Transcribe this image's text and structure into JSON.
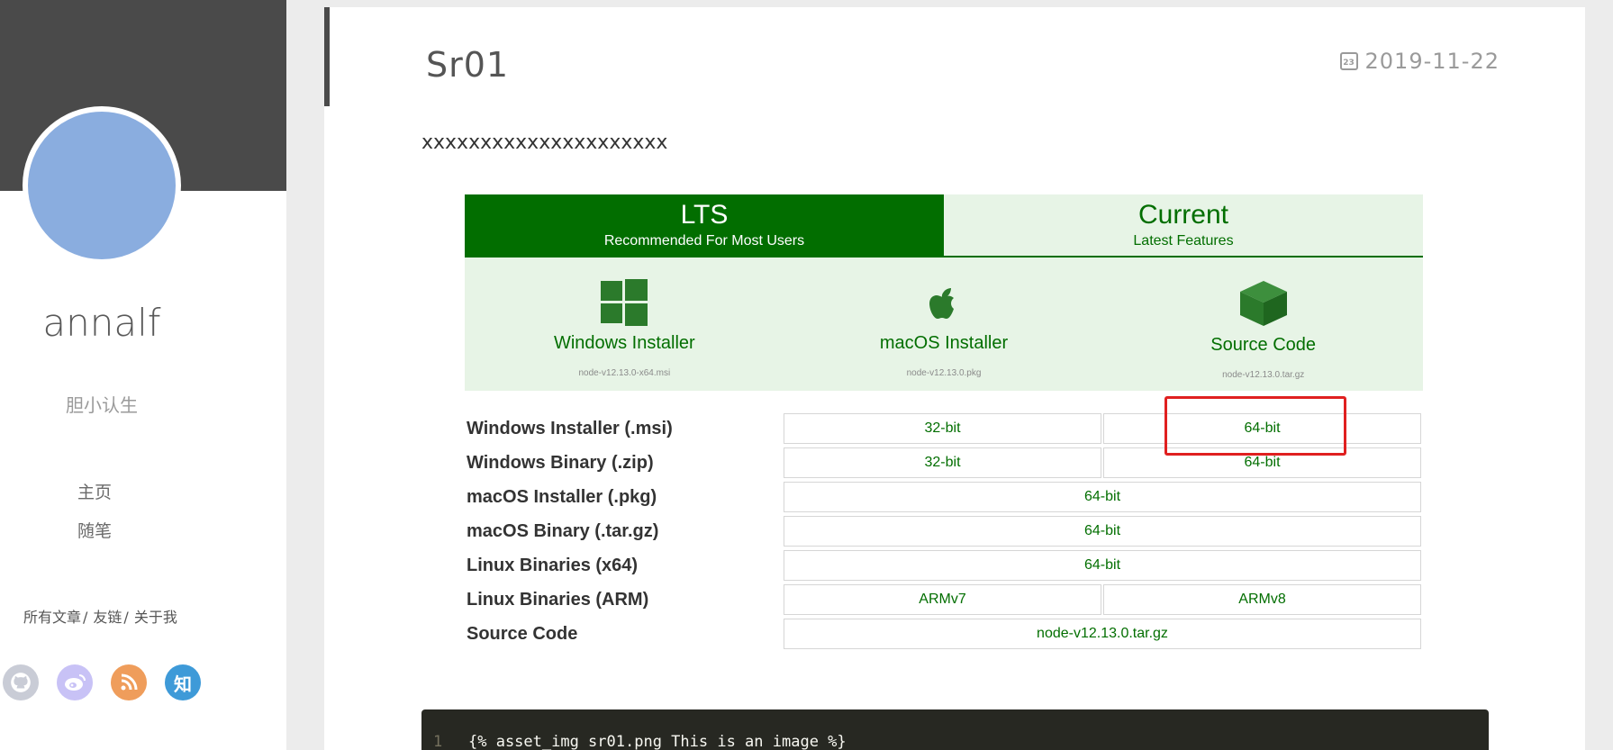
{
  "sidebar": {
    "username": "annalf",
    "motto": "胆小认生",
    "nav": [
      {
        "label": "主页"
      },
      {
        "label": "随笔"
      }
    ],
    "links": [
      {
        "label": "所有文章"
      },
      {
        "label": "友链"
      },
      {
        "label": "关于我"
      }
    ],
    "link_separator": "/",
    "social": [
      {
        "icon": "github-icon",
        "glyph": "",
        "color": "#c9ccd6"
      },
      {
        "icon": "weibo-icon",
        "glyph": "",
        "color": "#c8c2f6"
      },
      {
        "icon": "rss-icon",
        "glyph": "",
        "color": "#ef9d5b"
      },
      {
        "icon": "zhihu-icon",
        "glyph": "知",
        "color": "#3e9ad8"
      }
    ]
  },
  "post": {
    "title": "Sr01",
    "date": "2019-11-22",
    "calendar_day": "23",
    "body_text": "xxxxxxxxxxxxxxxxxxxxx"
  },
  "download_widget": {
    "tabs": [
      {
        "title": "LTS",
        "subtitle": "Recommended For Most Users",
        "active": true
      },
      {
        "title": "Current",
        "subtitle": "Latest Features",
        "active": false
      }
    ],
    "installers": [
      {
        "icon": "windows-icon",
        "label": "Windows Installer",
        "file": "node-v12.13.0-x64.msi"
      },
      {
        "icon": "apple-icon",
        "label": "macOS Installer",
        "file": "node-v12.13.0.pkg"
      },
      {
        "icon": "box-icon",
        "label": "Source Code",
        "file": "node-v12.13.0.tar.gz"
      }
    ],
    "rows": [
      {
        "label": "Windows Installer (.msi)",
        "cells": [
          "32-bit",
          "64-bit"
        ]
      },
      {
        "label": "Windows Binary (.zip)",
        "cells": [
          "32-bit",
          "64-bit"
        ]
      },
      {
        "label": "macOS Installer (.pkg)",
        "cells": [
          "64-bit"
        ]
      },
      {
        "label": "macOS Binary (.tar.gz)",
        "cells": [
          "64-bit"
        ]
      },
      {
        "label": "Linux Binaries (x64)",
        "cells": [
          "64-bit"
        ]
      },
      {
        "label": "Linux Binaries (ARM)",
        "cells": [
          "ARMv7",
          "ARMv8"
        ]
      },
      {
        "label": "Source Code",
        "cells": [
          "node-v12.13.0.tar.gz"
        ]
      }
    ],
    "accent_color": "#026e00",
    "highlight_color": "#e02020"
  },
  "code_block": {
    "line_number": "1",
    "code": "{% asset_img sr01.png This is an image %}"
  }
}
